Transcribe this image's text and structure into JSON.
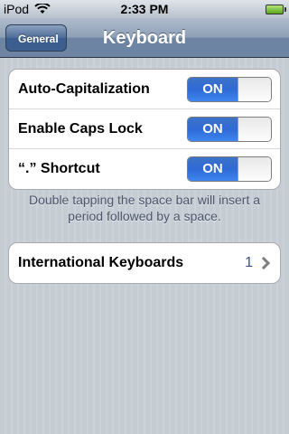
{
  "status_bar": {
    "carrier": "iPod",
    "time": "2:33 PM",
    "wifi_icon": "wifi-icon",
    "battery_icon": "battery-icon"
  },
  "nav": {
    "back_label": "General",
    "title": "Keyboard"
  },
  "settings": [
    {
      "label": "Auto-Capitalization",
      "toggle": "ON"
    },
    {
      "label": "Enable Caps Lock",
      "toggle": "ON"
    },
    {
      "label": "“.” Shortcut",
      "toggle": "ON"
    }
  ],
  "footer_note": "Double tapping the space bar will insert a period followed by a space.",
  "international": {
    "label": "International Keyboards",
    "count": "1",
    "chevron_icon": "chevron-right-icon"
  },
  "colors": {
    "toggle_on": "#2f6ad6",
    "nav_bar": "#6d84a2",
    "background": "#c5ccd4"
  }
}
